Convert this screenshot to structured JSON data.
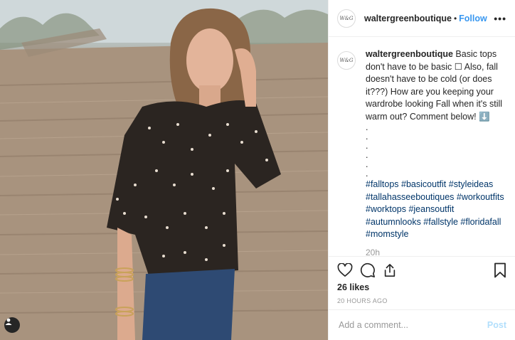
{
  "post": {
    "username": "waltergreenboutique",
    "follow_label": "Follow",
    "header_separator": "•",
    "more_label": "•••",
    "avatar_text": "W&G"
  },
  "caption": {
    "username": "waltergreenboutique",
    "text": "Basic tops don't have to be basic ☐ Also, fall doesn't have to be cold (or does it???) How are you keeping your wardrobe looking Fall when it's still warm out? Comment below! ⬇️",
    "dots": [
      ".",
      ".",
      ".",
      ".",
      ".",
      "."
    ],
    "hashtags": "#falltops #basicoutfit #styleideas #tallahasseeboutiques #workoutfits #worktops #jeansoutfit #autumnlooks #fallstyle #floridafall #momstyle",
    "time": "20h"
  },
  "actions": {
    "icons": [
      "heart-icon",
      "comment-icon",
      "share-icon",
      "bookmark-icon"
    ],
    "likes": "26 likes",
    "timestamp": "20 HOURS AGO"
  },
  "comment_box": {
    "placeholder": "Add a comment...",
    "post_label": "Post"
  },
  "colors": {
    "link": "#3897f0",
    "hashtag": "#003569",
    "post_disabled": "#b2dffc"
  }
}
